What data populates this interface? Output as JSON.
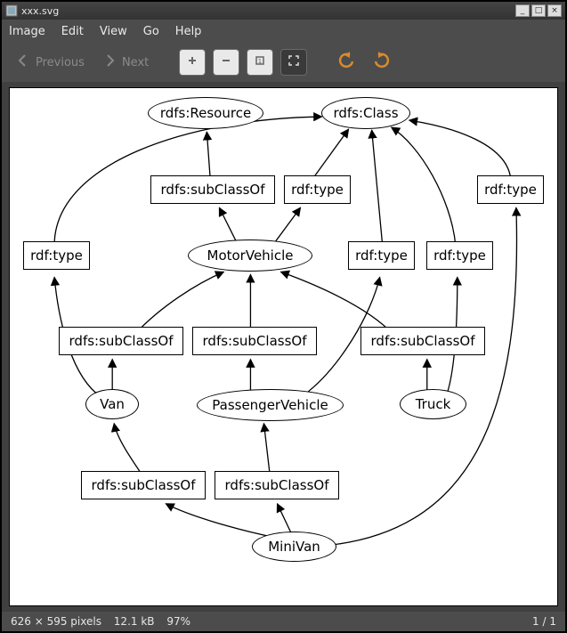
{
  "window": {
    "title": "xxx.svg",
    "controls": {
      "minimize": "_",
      "maximize": "□",
      "close": "×"
    }
  },
  "menubar": {
    "items": [
      "Image",
      "Edit",
      "View",
      "Go",
      "Help"
    ]
  },
  "toolbar": {
    "previous_label": "Previous",
    "next_label": "Next"
  },
  "statusbar": {
    "dimensions": "626 × 595 pixels",
    "filesize": "12.1 kB",
    "zoom": "97%",
    "page": "1 / 1"
  },
  "graph": {
    "ellipses": {
      "resource": {
        "label": "rdfs:Resource"
      },
      "class": {
        "label": "rdfs:Class"
      },
      "motorvehicle": {
        "label": "MotorVehicle"
      },
      "van": {
        "label": "Van"
      },
      "passengervehicle": {
        "label": "PassengerVehicle"
      },
      "truck": {
        "label": "Truck"
      },
      "minivan": {
        "label": "MiniVan"
      }
    },
    "rects": {
      "sco_mv": {
        "label": "rdfs:subClassOf"
      },
      "type_mv": {
        "label": "rdf:type"
      },
      "type_left": {
        "label": "rdf:type"
      },
      "type_mid": {
        "label": "rdf:type"
      },
      "type_right": {
        "label": "rdf:type"
      },
      "type_far": {
        "label": "rdf:type"
      },
      "sco_van": {
        "label": "rdfs:subClassOf"
      },
      "sco_pv": {
        "label": "rdfs:subClassOf"
      },
      "sco_truck": {
        "label": "rdfs:subClassOf"
      },
      "sco_mv_van": {
        "label": "rdfs:subClassOf"
      },
      "sco_mv_pv": {
        "label": "rdfs:subClassOf"
      }
    }
  }
}
